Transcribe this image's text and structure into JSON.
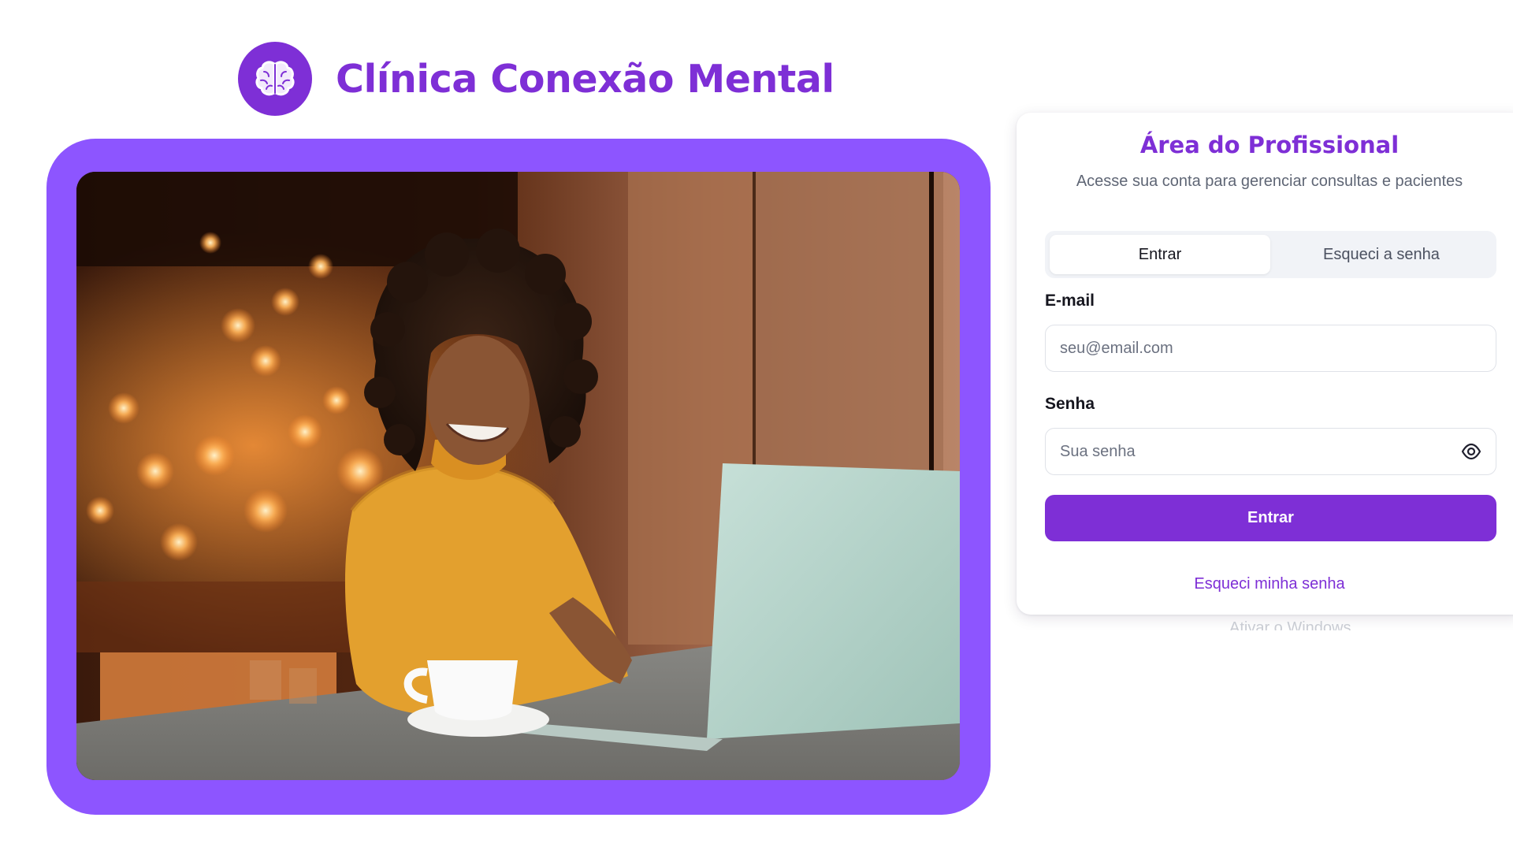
{
  "brand": {
    "name": "Clínica Conexão Mental",
    "logo_icon": "brain-icon",
    "color": "#7e2fd6"
  },
  "hero": {
    "frame_color": "#8d55ff"
  },
  "login": {
    "title": "Área do Profissional",
    "subtitle": "Acesse sua conta para gerenciar consultas e pacientes",
    "tabs": [
      {
        "label": "Entrar",
        "active": true
      },
      {
        "label": "Esqueci a senha",
        "active": false
      }
    ],
    "email": {
      "label": "E-mail",
      "placeholder": "seu@email.com",
      "value": ""
    },
    "password": {
      "label": "Senha",
      "placeholder": "Sua senha",
      "value": "",
      "toggle_icon": "eye-icon"
    },
    "submit_label": "Entrar",
    "forgot_link": "Esqueci minha senha",
    "accent_color": "#7e2fd6"
  },
  "watermark": "Ativar o Windows"
}
